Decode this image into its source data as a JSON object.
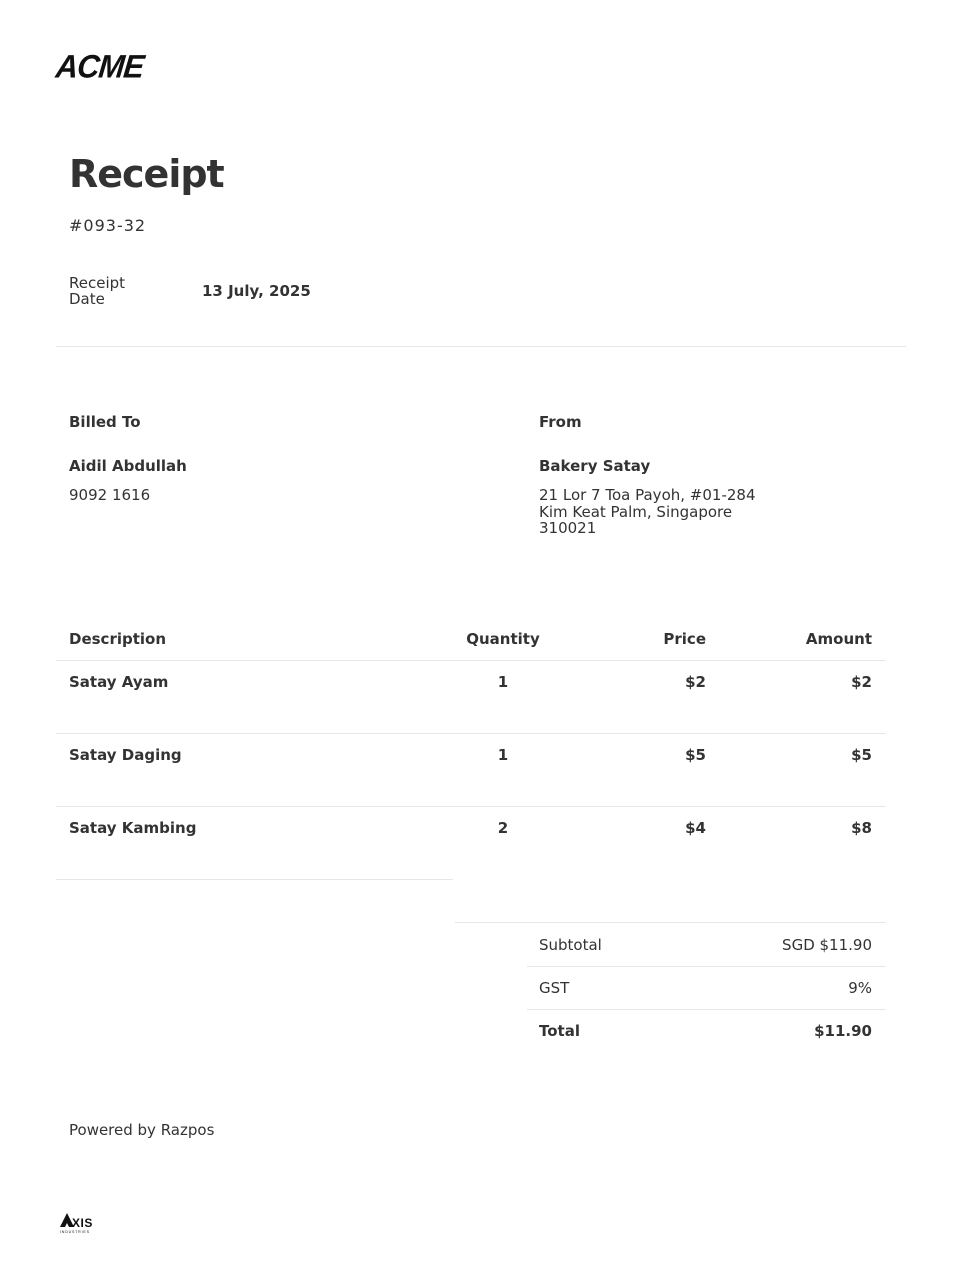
{
  "brand": {
    "logo_text": "ACME"
  },
  "header": {
    "title": "Receipt",
    "receipt_number": "#093-32",
    "date_label": "Receipt Date",
    "date_value": "13 July, 2025"
  },
  "billed_to": {
    "heading": "Billed To",
    "name": "Aidil Abdullah",
    "phone": "9092 1616"
  },
  "from": {
    "heading": "From",
    "name": "Bakery Satay",
    "address": "21 Lor 7 Toa Payoh, #01-284\nKim Keat Palm, Singapore\n310021"
  },
  "table": {
    "columns": [
      "Description",
      "Quantity",
      "Price",
      "Amount"
    ],
    "rows": [
      {
        "description": "Satay Ayam",
        "quantity": "1",
        "price": "$2",
        "amount": "$2"
      },
      {
        "description": "Satay Daging",
        "quantity": "1",
        "price": "$5",
        "amount": "$5"
      },
      {
        "description": "Satay Kambing",
        "quantity": "2",
        "price": "$4",
        "amount": "$8"
      }
    ]
  },
  "summary": {
    "subtotal_label": "Subtotal",
    "subtotal_value": "SGD $11.90",
    "gst_label": "GST",
    "gst_value": "9%",
    "total_label": "Total",
    "total_value": "$11.90"
  },
  "footer": {
    "powered_by": "Powered by Razpos",
    "axis_logo_text": "AXIS",
    "axis_logo_subtext": "INDUSTRIES"
  }
}
